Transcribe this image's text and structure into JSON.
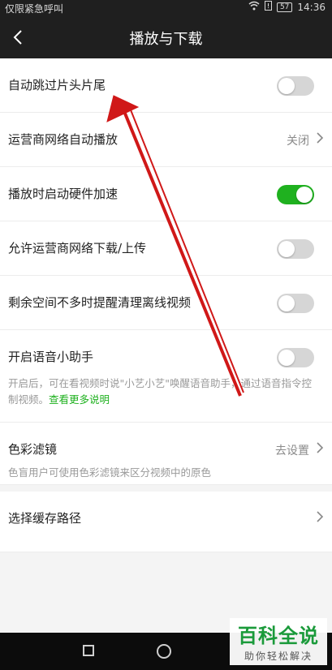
{
  "status_bar": {
    "carrier": "仅限紧急呼叫",
    "battery": "57",
    "time": "14:36"
  },
  "header": {
    "title": "播放与下载"
  },
  "settings": {
    "skip_intro": {
      "label": "自动跳过片头片尾",
      "enabled": false
    },
    "carrier_autoplay": {
      "label": "运营商网络自动播放",
      "value": "关闭"
    },
    "hw_accel": {
      "label": "播放时启动硬件加速",
      "enabled": true
    },
    "carrier_download": {
      "label": "允许运营商网络下载/上传",
      "enabled": false
    },
    "low_storage": {
      "label": "剩余空间不多时提醒清理离线视频",
      "enabled": false
    },
    "voice_assistant": {
      "label": "开启语音小助手",
      "enabled": false,
      "description": "开启后，可在看视频时说\"小艺小艺\"唤醒语音助手，通过语音指令控制视频。",
      "link": "查看更多说明"
    },
    "color_filter": {
      "label": "色彩滤镜",
      "value": "去设置",
      "description": "色盲用户可使用色彩滤镜来区分视频中的原色"
    },
    "cache_path": {
      "label": "选择缓存路径"
    }
  },
  "watermark": {
    "title": "百科全说",
    "subtitle": "助你轻松解决"
  },
  "colors": {
    "toggle_on": "#1fb11f",
    "toggle_off": "#d6d6d6",
    "annotation_arrow": "#d01818"
  }
}
